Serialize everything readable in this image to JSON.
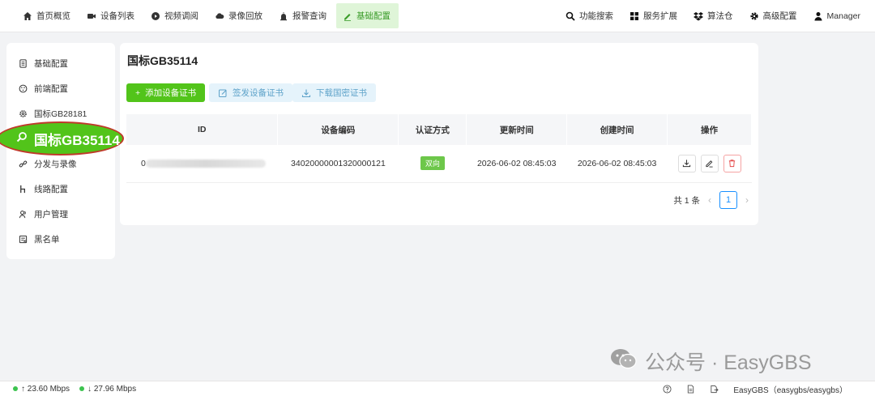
{
  "nav": {
    "left": [
      {
        "label": "首页概览",
        "icon": "home-icon"
      },
      {
        "label": "设备列表",
        "icon": "camera-icon"
      },
      {
        "label": "视频调阅",
        "icon": "play-circle-icon"
      },
      {
        "label": "录像回放",
        "icon": "cloud-icon"
      },
      {
        "label": "报警查询",
        "icon": "alarm-icon"
      },
      {
        "label": "基础配置",
        "icon": "edit-icon",
        "active": true
      }
    ],
    "right": [
      {
        "label": "功能搜索",
        "icon": "search-icon"
      },
      {
        "label": "服务扩展",
        "icon": "apps-icon"
      },
      {
        "label": "算法仓",
        "icon": "dropbox-icon"
      },
      {
        "label": "高级配置",
        "icon": "gear-icon"
      },
      {
        "label": "Manager",
        "icon": "user-icon"
      }
    ]
  },
  "sidebar": {
    "items": [
      {
        "label": "基础配置",
        "icon": "document-icon"
      },
      {
        "label": "前端配置",
        "icon": "palette-icon"
      },
      {
        "label": "国标GB28181",
        "icon": "settings-icon"
      },
      {
        "label": "国标GB35114",
        "icon": "search-icon",
        "highlighted": true
      },
      {
        "label": "分发与录像",
        "icon": "link-icon"
      },
      {
        "label": "线路配置",
        "icon": "route-icon"
      },
      {
        "label": "用户管理",
        "icon": "users-icon"
      },
      {
        "label": "黑名单",
        "icon": "blacklist-icon"
      }
    ]
  },
  "main": {
    "title": "国标GB35114",
    "buttons": {
      "add": "添加设备证书",
      "issue": "签发设备证书",
      "download": "下载国密证书"
    },
    "table": {
      "headers": [
        "ID",
        "设备编码",
        "认证方式",
        "更新时间",
        "创建时间",
        "操作"
      ],
      "rows": [
        {
          "id": "0",
          "device_code": "34020000001320000121",
          "auth": "双向",
          "updated": "2026-06-02 08:45:03",
          "created": "2026-06-02 08:45:03"
        }
      ]
    },
    "pagination": {
      "total": "共 1 条",
      "current": "1"
    }
  },
  "watermark": {
    "text": "公众号 · EasyGBS"
  },
  "statusbar": {
    "upload": "↑ 23.60 Mbps",
    "download": "↓ 27.96 Mbps",
    "version": "EasyGBS（easygbs/easygbs）"
  },
  "colors": {
    "accent": "#52c41a",
    "active_nav_bg": "#dff5d8",
    "soft_button_bg": "#e5f3fb",
    "highlight_border": "#c0392b"
  }
}
